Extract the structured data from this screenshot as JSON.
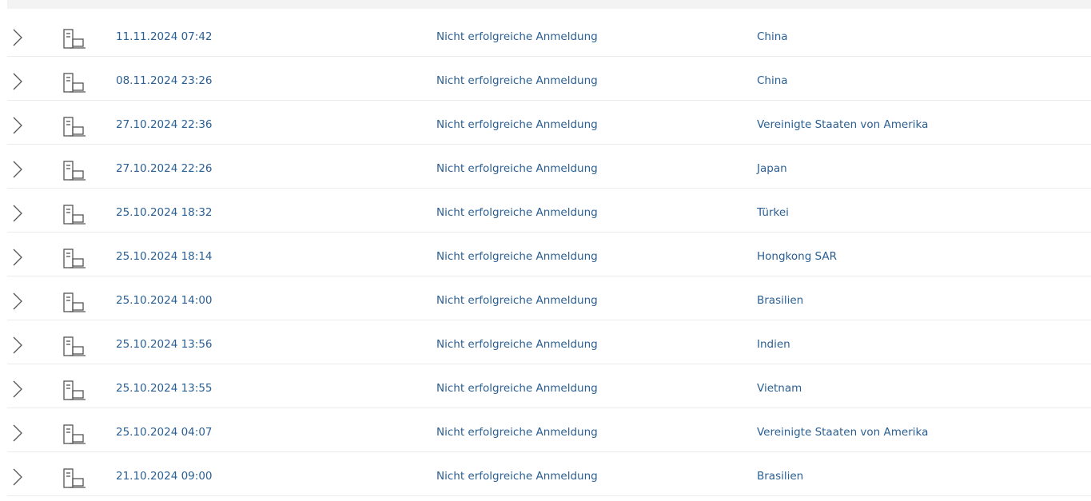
{
  "activity": {
    "rows": [
      {
        "date": "11.11.2024 07:42",
        "type": "Nicht erfolgreiche Anmeldung",
        "location": "China"
      },
      {
        "date": "08.11.2024 23:26",
        "type": "Nicht erfolgreiche Anmeldung",
        "location": "China"
      },
      {
        "date": "27.10.2024 22:36",
        "type": "Nicht erfolgreiche Anmeldung",
        "location": "Vereinigte Staaten von Amerika"
      },
      {
        "date": "27.10.2024 22:26",
        "type": "Nicht erfolgreiche Anmeldung",
        "location": "Japan"
      },
      {
        "date": "25.10.2024 18:32",
        "type": "Nicht erfolgreiche Anmeldung",
        "location": "Türkei"
      },
      {
        "date": "25.10.2024 18:14",
        "type": "Nicht erfolgreiche Anmeldung",
        "location": "Hongkong SAR"
      },
      {
        "date": "25.10.2024 14:00",
        "type": "Nicht erfolgreiche Anmeldung",
        "location": "Brasilien"
      },
      {
        "date": "25.10.2024 13:56",
        "type": "Nicht erfolgreiche Anmeldung",
        "location": "Indien"
      },
      {
        "date": "25.10.2024 13:55",
        "type": "Nicht erfolgreiche Anmeldung",
        "location": "Vietnam"
      },
      {
        "date": "25.10.2024 04:07",
        "type": "Nicht erfolgreiche Anmeldung",
        "location": "Vereinigte Staaten von Amerika"
      },
      {
        "date": "21.10.2024 09:00",
        "type": "Nicht erfolgreiche Anmeldung",
        "location": "Brasilien"
      }
    ],
    "icons": {
      "expand": "chevron-right-icon",
      "device": "computer-device-icon"
    },
    "colors": {
      "link_text": "#2a5f93",
      "icon": "#555555",
      "divider": "#ebebeb",
      "header_band": "#f3f3f3"
    }
  }
}
